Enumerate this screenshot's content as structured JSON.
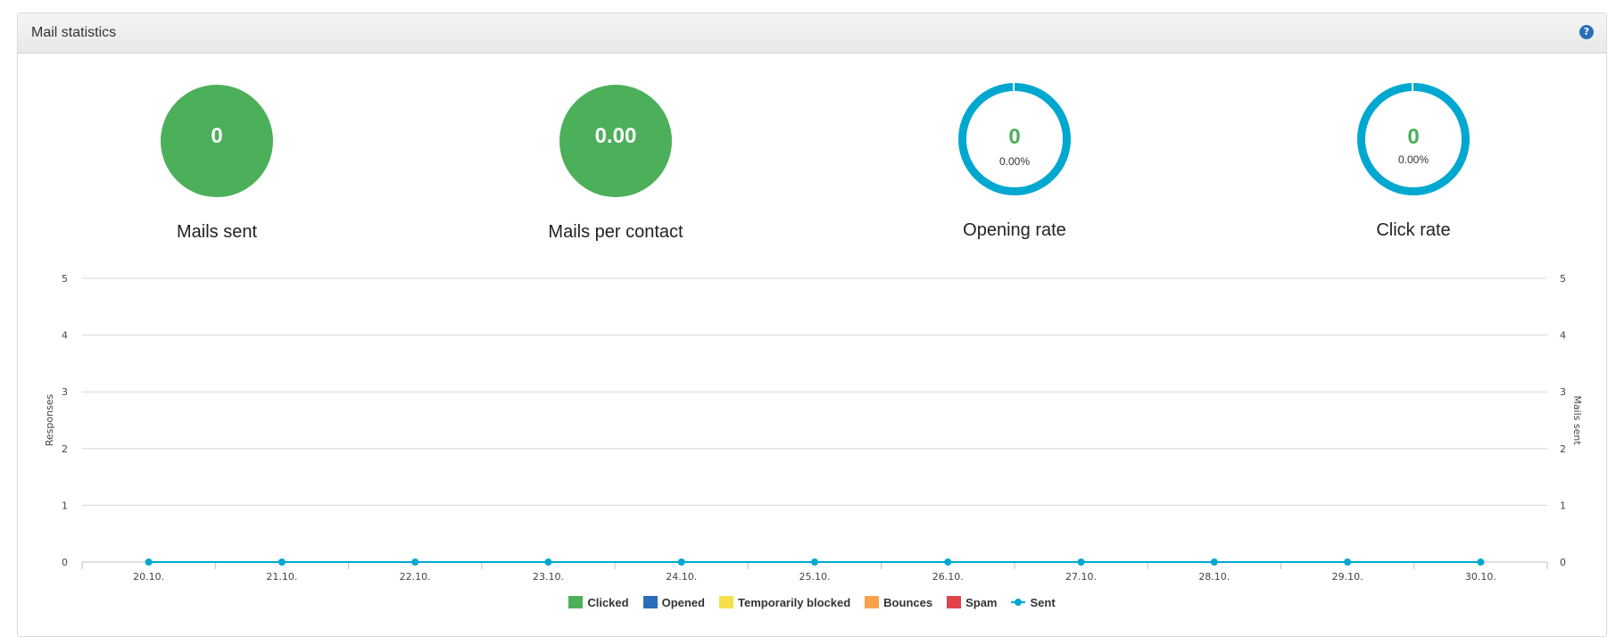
{
  "panel": {
    "title": "Mail statistics",
    "help_icon": "question-icon"
  },
  "kpis": [
    {
      "value": "0",
      "label": "Mails sent",
      "style": "solid"
    },
    {
      "value": "0.00",
      "label": "Mails per contact",
      "style": "solid"
    },
    {
      "value": "0",
      "percent": "0.00%",
      "label": "Opening rate",
      "style": "ring"
    },
    {
      "value": "0",
      "percent": "0.00%",
      "label": "Click rate",
      "style": "ring"
    }
  ],
  "colors": {
    "green": "#4caf5a",
    "ring": "#00a8d0",
    "clicked": "#4caf5a",
    "opened": "#2a6ebb",
    "temporarily_blocked": "#f5e04a",
    "bounces": "#f7a24a",
    "spam": "#e0434a",
    "sent": "#00a8d0"
  },
  "chart_data": {
    "type": "line",
    "categories": [
      "20.10.",
      "21.10.",
      "22.10.",
      "23.10.",
      "24.10.",
      "25.10.",
      "26.10.",
      "27.10.",
      "28.10.",
      "29.10.",
      "30.10."
    ],
    "series": [
      {
        "name": "Clicked",
        "type": "bar",
        "values": [
          0,
          0,
          0,
          0,
          0,
          0,
          0,
          0,
          0,
          0,
          0
        ]
      },
      {
        "name": "Opened",
        "type": "bar",
        "values": [
          0,
          0,
          0,
          0,
          0,
          0,
          0,
          0,
          0,
          0,
          0
        ]
      },
      {
        "name": "Temporarily blocked",
        "type": "bar",
        "values": [
          0,
          0,
          0,
          0,
          0,
          0,
          0,
          0,
          0,
          0,
          0
        ]
      },
      {
        "name": "Bounces",
        "type": "bar",
        "values": [
          0,
          0,
          0,
          0,
          0,
          0,
          0,
          0,
          0,
          0,
          0
        ]
      },
      {
        "name": "Spam",
        "type": "bar",
        "values": [
          0,
          0,
          0,
          0,
          0,
          0,
          0,
          0,
          0,
          0,
          0
        ]
      },
      {
        "name": "Sent",
        "type": "line",
        "values": [
          0,
          0,
          0,
          0,
          0,
          0,
          0,
          0,
          0,
          0,
          0
        ]
      }
    ],
    "ylabel": "Responses",
    "y2label": "Mails sent",
    "ylim": [
      0,
      5
    ],
    "y2lim": [
      0,
      5
    ],
    "yticks": [
      "0",
      "1",
      "2",
      "3",
      "4",
      "5"
    ],
    "grid": true,
    "legend_position": "bottom"
  },
  "legend": [
    {
      "label": "Clicked",
      "color": "#4caf5a",
      "kind": "swatch"
    },
    {
      "label": "Opened",
      "color": "#2a6ebb",
      "kind": "swatch"
    },
    {
      "label": "Temporarily blocked",
      "color": "#f5e04a",
      "kind": "swatch"
    },
    {
      "label": "Bounces",
      "color": "#f7a24a",
      "kind": "swatch"
    },
    {
      "label": "Spam",
      "color": "#e0434a",
      "kind": "swatch"
    },
    {
      "label": "Sent",
      "color": "#00a8d0",
      "kind": "line"
    }
  ]
}
